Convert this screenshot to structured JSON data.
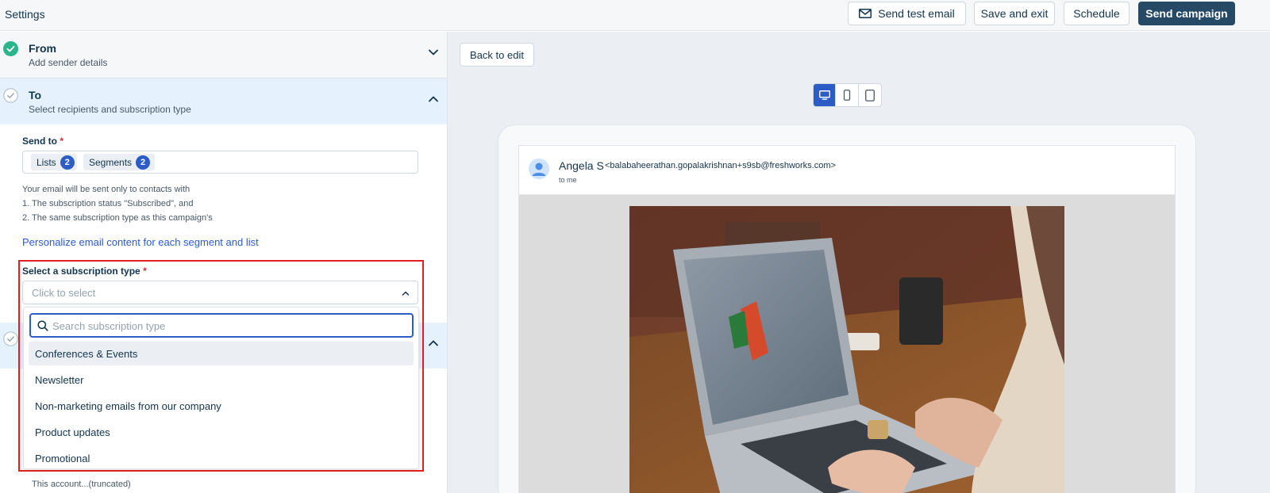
{
  "header": {
    "title": "Settings",
    "send_test_label": "Send test email",
    "save_exit_label": "Save and exit",
    "schedule_label": "Schedule",
    "send_campaign_label": "Send campaign"
  },
  "from_section": {
    "title": "From",
    "subtitle": "Add sender details"
  },
  "to_section": {
    "title": "To",
    "subtitle": "Select recipients and subscription type",
    "send_to_label": "Send to",
    "required_mark": "*",
    "chips": [
      {
        "label": "Lists",
        "count": "2"
      },
      {
        "label": "Segments",
        "count": "2"
      }
    ],
    "info_lines": [
      "Your email will be sent only to contacts with",
      "1. The subscription status \"Subscribed\", and",
      "2. The same subscription type as this campaign's"
    ],
    "personalize_link": "Personalize email content for each segment and list",
    "subscription_label": "Select a subscription type",
    "subscription_placeholder": "Click to select",
    "search_placeholder": "Search subscription type",
    "options": [
      "Conferences & Events",
      "Newsletter",
      "Non-marketing emails from our company",
      "Product updates",
      "Promotional"
    ],
    "bottom_text": "This account...(truncated)"
  },
  "preview": {
    "back_label": "Back to edit",
    "devices": [
      "desktop-icon",
      "mobile-icon",
      "tablet-icon"
    ],
    "sender_name": "Angela S",
    "sender_email": "<balabaheerathan.gopalakrishnan+s9sb@freshworks.com>",
    "to_text": "to me"
  },
  "colors": {
    "accent": "#2c5cc5",
    "primary_button": "#264966",
    "success": "#2bb58b",
    "highlight": "#e02020"
  }
}
